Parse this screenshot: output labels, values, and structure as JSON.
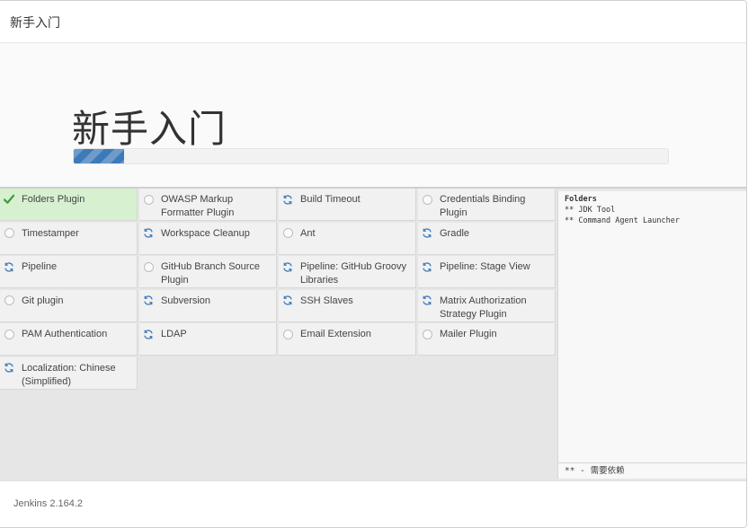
{
  "header": {
    "title": "新手入门"
  },
  "hero": {
    "title": "新手入门",
    "progress_fraction": 0.084
  },
  "plugins": [
    [
      {
        "label": "Folders Plugin",
        "status": "done"
      },
      {
        "label": "Timestamper",
        "status": "pending"
      },
      {
        "label": "Pipeline",
        "status": "installing"
      },
      {
        "label": "Git plugin",
        "status": "pending"
      },
      {
        "label": "PAM Authentication",
        "status": "pending"
      },
      {
        "label": "Localization: Chinese (Simplified)",
        "status": "installing"
      }
    ],
    [
      {
        "label": "OWASP Markup Formatter Plugin",
        "status": "pending"
      },
      {
        "label": "Workspace Cleanup",
        "status": "installing"
      },
      {
        "label": "GitHub Branch Source Plugin",
        "status": "pending"
      },
      {
        "label": "Subversion",
        "status": "installing"
      },
      {
        "label": "LDAP",
        "status": "installing"
      }
    ],
    [
      {
        "label": "Build Timeout",
        "status": "installing"
      },
      {
        "label": "Ant",
        "status": "pending"
      },
      {
        "label": "Pipeline: GitHub Groovy Libraries",
        "status": "installing"
      },
      {
        "label": "SSH Slaves",
        "status": "installing"
      },
      {
        "label": "Email Extension",
        "status": "pending"
      }
    ],
    [
      {
        "label": "Credentials Binding Plugin",
        "status": "pending"
      },
      {
        "label": "Gradle",
        "status": "installing"
      },
      {
        "label": "Pipeline: Stage View",
        "status": "installing"
      },
      {
        "label": "Matrix Authorization Strategy Plugin",
        "status": "installing"
      },
      {
        "label": "Mailer Plugin",
        "status": "pending"
      }
    ]
  ],
  "log": {
    "title": "Folders",
    "lines": [
      "** JDK Tool",
      "** Command Agent Launcher"
    ],
    "footnote": "** - 需要依赖"
  },
  "footer": {
    "version": "Jenkins 2.164.2"
  },
  "colors": {
    "done_bg": "#d6f0d0",
    "check": "#3c9a3c",
    "installing": "#3d7ab8",
    "progress": "#3d7ab8"
  }
}
